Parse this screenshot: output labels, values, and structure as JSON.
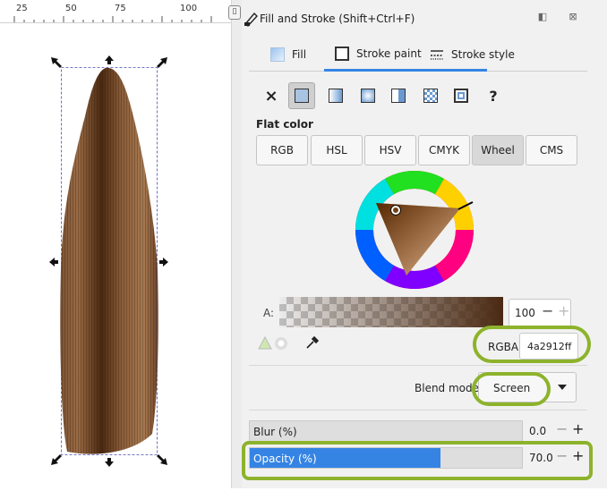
{
  "ruler": {
    "marks": [
      "25",
      "50",
      "75",
      "100"
    ]
  },
  "dialog": {
    "title": "Fill and Stroke (Shift+Ctrl+F)",
    "tabs": [
      {
        "label": "Fill",
        "icon": "fill-icon"
      },
      {
        "label": "Stroke paint",
        "icon": "stroke-paint-icon"
      },
      {
        "label": "Stroke style",
        "icon": "stroke-style-icon"
      }
    ],
    "active_tab": "Stroke paint",
    "paint_modes": [
      "no-paint-icon",
      "flat-color-icon",
      "linear-gradient-icon",
      "radial-gradient-icon",
      "mesh-gradient-icon",
      "pattern-icon",
      "swatch-icon",
      "unset-icon"
    ],
    "paint_mode_glyphs": {
      "none": "×",
      "unset": "?"
    },
    "flat_color_label": "Flat color",
    "color_models": [
      "RGB",
      "HSL",
      "HSV",
      "CMYK",
      "Wheel",
      "CMS"
    ],
    "active_model": "Wheel",
    "alpha": {
      "label": "A:",
      "value": "100",
      "minus": "−",
      "plus": "+"
    },
    "rgba": {
      "label": "RGBA:",
      "value": "4a2912ff"
    },
    "blend": {
      "label": "Blend mode:",
      "value": "Screen"
    },
    "blur": {
      "label": "Blur (%)",
      "value": "0.0",
      "minus": "−",
      "plus": "+"
    },
    "opacity": {
      "label": "Opacity (%)",
      "value": "70.0",
      "level_percent": 70,
      "minus": "−",
      "plus": "+"
    }
  },
  "colors": {
    "accent": "#3584e4",
    "highlight": "#8db32c",
    "selected_color": "#4a2912"
  }
}
